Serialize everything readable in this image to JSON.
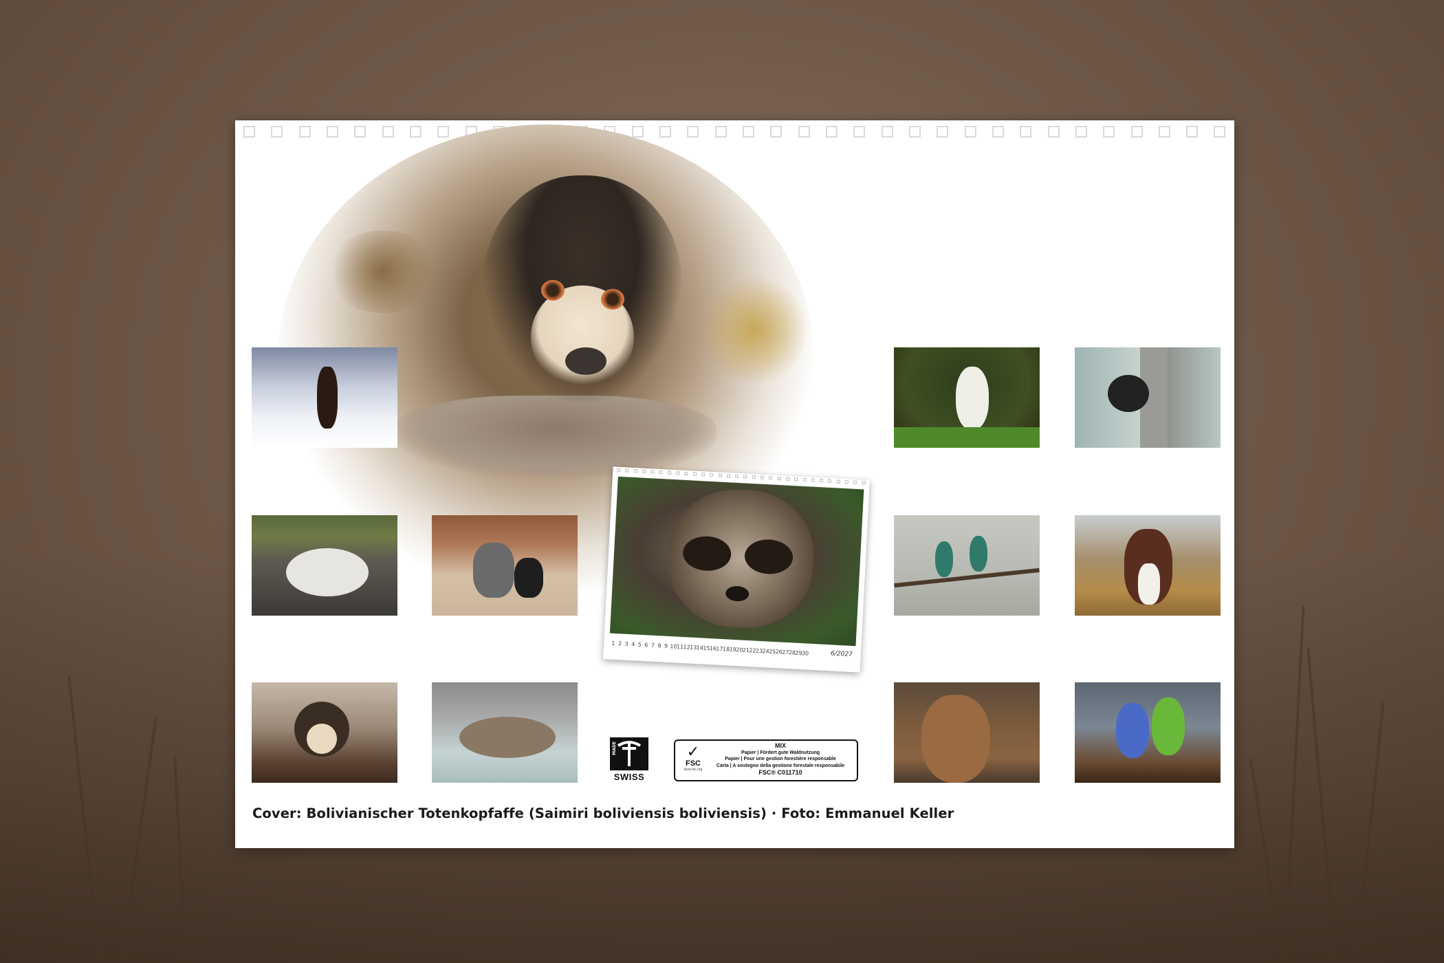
{
  "calendar": {
    "caption": "Cover: Bolivianischer Totenkopfaffe (Saimiri boliviensis boliviensis) · Foto: Emmanuel Keller",
    "preview": {
      "days": [
        "1",
        "2",
        "3",
        "4",
        "5",
        "6",
        "7",
        "8",
        "9",
        "10",
        "11",
        "12",
        "13",
        "14",
        "15",
        "16",
        "17",
        "18",
        "19",
        "20",
        "21",
        "22",
        "23",
        "24",
        "25",
        "26",
        "27",
        "28",
        "29",
        "30"
      ],
      "month_label": "6/2027"
    },
    "swiss_badge": {
      "made": "MADE",
      "label": "SWISS"
    },
    "fsc_label": {
      "mix": "MIX",
      "line1": "Papier | Fördert gute Waldnutzung",
      "line2": "Papier | Pour une gestion forestière responsable",
      "line3": "Carta | A sostegno della gestione forestale responsabile",
      "code": "FSC® C011710",
      "logo_word": "FSC",
      "site": "www.fsc.org"
    }
  }
}
